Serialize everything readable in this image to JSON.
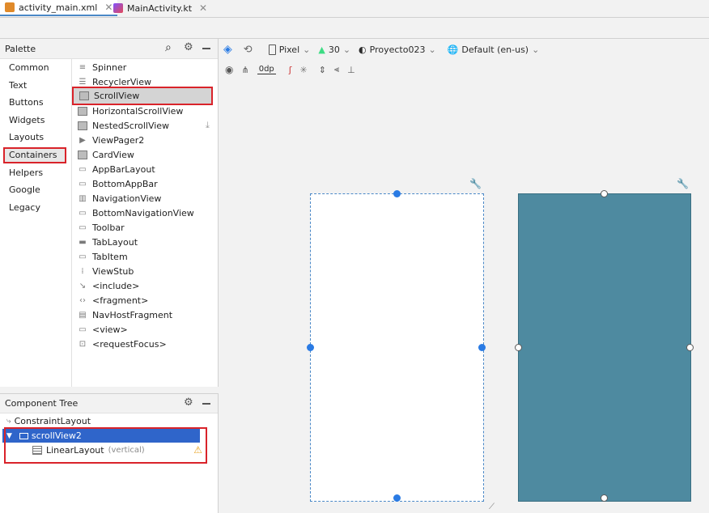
{
  "tabs": [
    {
      "label": "activity_main.xml",
      "icon": "xml-file-icon",
      "active": true
    },
    {
      "label": "MainActivity.kt",
      "icon": "kotlin-file-icon",
      "active": false
    }
  ],
  "palette": {
    "title": "Palette",
    "categories": [
      "Common",
      "Text",
      "Buttons",
      "Widgets",
      "Layouts",
      "Containers",
      "Helpers",
      "Google",
      "Legacy"
    ],
    "selected_category": "Containers",
    "items": [
      {
        "label": "Spinner",
        "icon": "spinner-icon"
      },
      {
        "label": "RecyclerView",
        "icon": "list-icon"
      },
      {
        "label": "ScrollView",
        "icon": "scrollview-icon",
        "selected": true
      },
      {
        "label": "HorizontalScrollView",
        "icon": "scrollview-icon"
      },
      {
        "label": "NestedScrollView",
        "icon": "scrollview-icon"
      },
      {
        "label": "ViewPager2",
        "icon": "viewpager-icon"
      },
      {
        "label": "CardView",
        "icon": "cardview-icon"
      },
      {
        "label": "AppBarLayout",
        "icon": "appbar-icon"
      },
      {
        "label": "BottomAppBar",
        "icon": "bottom-appbar-icon"
      },
      {
        "label": "NavigationView",
        "icon": "navigation-icon"
      },
      {
        "label": "BottomNavigationView",
        "icon": "bottom-navigation-icon"
      },
      {
        "label": "Toolbar",
        "icon": "toolbar-icon"
      },
      {
        "label": "TabLayout",
        "icon": "tablayout-icon"
      },
      {
        "label": "TabItem",
        "icon": "tabitem-icon"
      },
      {
        "label": "ViewStub",
        "icon": "viewstub-icon"
      },
      {
        "label": "<include>",
        "icon": "include-icon"
      },
      {
        "label": "<fragment>",
        "icon": "fragment-icon"
      },
      {
        "label": "NavHostFragment",
        "icon": "navhost-icon"
      },
      {
        "label": "<view>",
        "icon": "view-icon"
      },
      {
        "label": "<requestFocus>",
        "icon": "focus-icon"
      }
    ]
  },
  "component_tree": {
    "title": "Component Tree",
    "nodes": [
      {
        "label": "ConstraintLayout",
        "hint": "",
        "depth": 0,
        "selected": false
      },
      {
        "label": "scrollView2",
        "hint": "",
        "depth": 1,
        "selected": true
      },
      {
        "label": "LinearLayout",
        "hint": "(vertical)",
        "depth": 2,
        "selected": false,
        "warning": true
      }
    ]
  },
  "toolbar": {
    "device": "Pixel",
    "api": "30",
    "theme": "Proyecto023",
    "locale": "Default (en-us)",
    "margin": "0dp"
  },
  "colors": {
    "accent": "#2a7be4",
    "selection": "#d9232a",
    "blueprint": "#4e8aa0",
    "tree_selected": "#2f65ca"
  }
}
